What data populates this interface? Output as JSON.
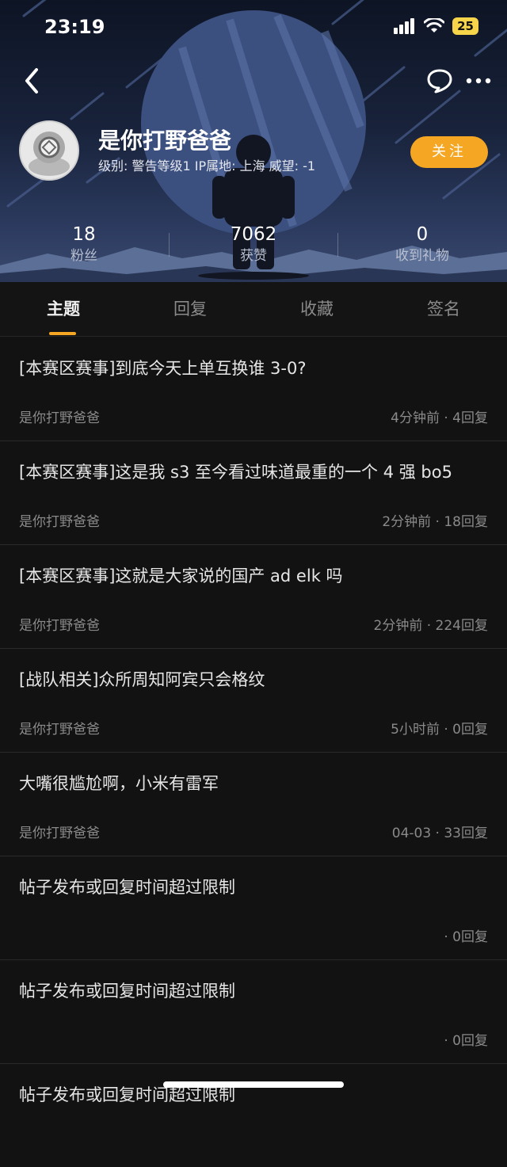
{
  "status_bar": {
    "time": "23:19",
    "battery": "25"
  },
  "profile": {
    "username": "是你打野爸爸",
    "info": "级别: 警告等级1  IP属地: 上海  威望: -1",
    "follow_label": "关注"
  },
  "stats": [
    {
      "value": "18",
      "label": "粉丝"
    },
    {
      "value": "7062",
      "label": "获赞"
    },
    {
      "value": "0",
      "label": "收到礼物"
    }
  ],
  "tabs": [
    {
      "label": "主题",
      "active": true
    },
    {
      "label": "回复",
      "active": false
    },
    {
      "label": "收藏",
      "active": false
    },
    {
      "label": "签名",
      "active": false
    }
  ],
  "posts": [
    {
      "title": "[本赛区赛事]到底今天上单互换谁 3-0?",
      "author": "是你打野爸爸",
      "meta": "4分钟前 · 4回复"
    },
    {
      "title": "[本赛区赛事]这是我 s3 至今看过味道最重的一个 4 强 bo5",
      "author": "是你打野爸爸",
      "meta": "2分钟前 · 18回复"
    },
    {
      "title": "[本赛区赛事]这就是大家说的国产 ad elk 吗",
      "author": "是你打野爸爸",
      "meta": "2分钟前 · 224回复"
    },
    {
      "title": "[战队相关]众所周知阿宾只会格纹",
      "author": "是你打野爸爸",
      "meta": "5小时前 · 0回复"
    },
    {
      "title": "大嘴很尴尬啊，小米有雷军",
      "author": "是你打野爸爸",
      "meta": "04-03 · 33回复"
    },
    {
      "title": "帖子发布或回复时间超过限制",
      "author": "",
      "meta": "· 0回复"
    },
    {
      "title": "帖子发布或回复时间超过限制",
      "author": "",
      "meta": "· 0回复"
    },
    {
      "title": "帖子发布或回复时间超过限制",
      "author": "",
      "meta": ""
    }
  ],
  "colors": {
    "accent": "#f5a623",
    "background": "#121212"
  }
}
